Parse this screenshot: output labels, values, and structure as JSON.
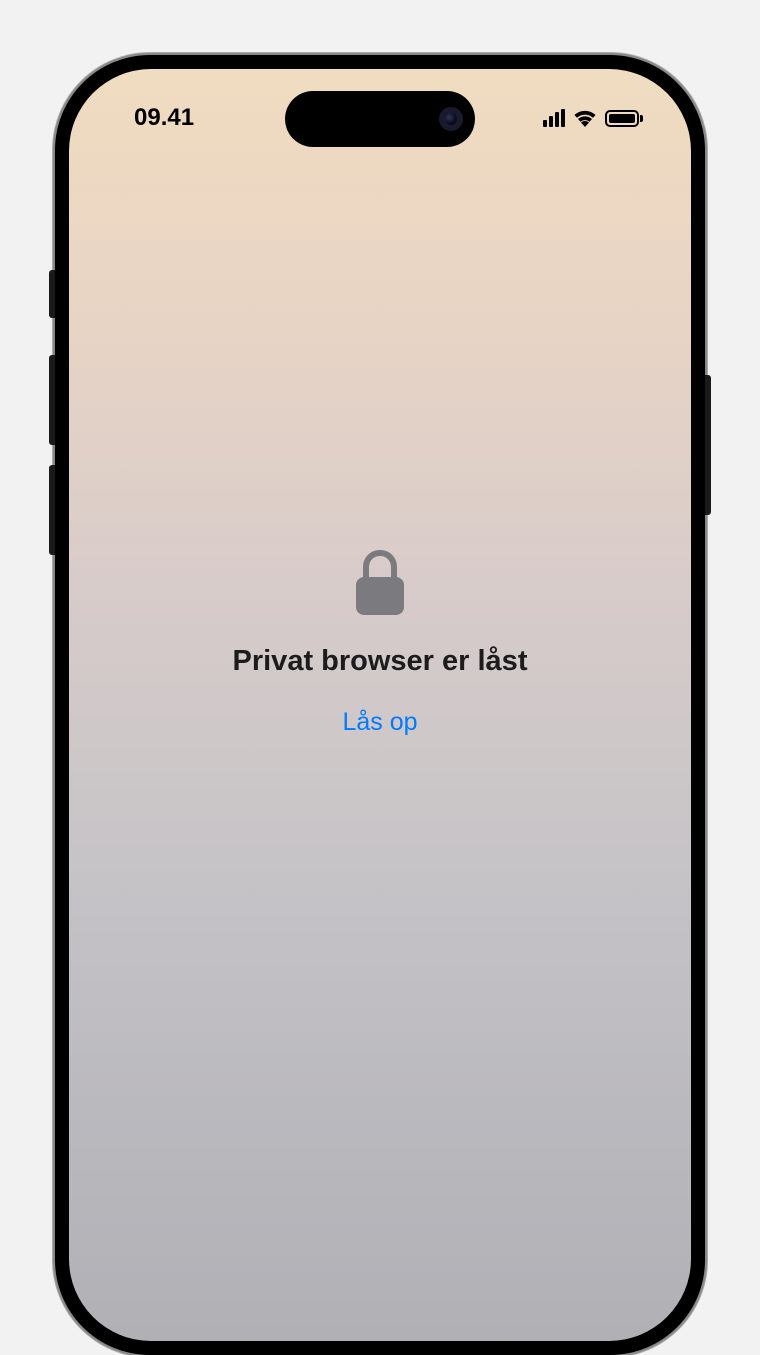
{
  "status_bar": {
    "time": "09.41"
  },
  "lock_screen": {
    "title": "Privat browser er låst",
    "unlock_label": "Lås op"
  },
  "colors": {
    "link": "#007aff",
    "text": "#1c1c1e"
  }
}
